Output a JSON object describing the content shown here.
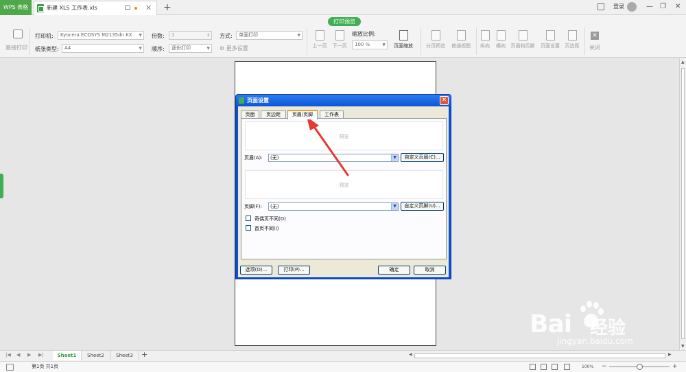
{
  "tabbar": {
    "app_tab": "WPS 表格",
    "doc_tab": "新建 XLS 工作表.xls",
    "login": "登录"
  },
  "ribbon": {
    "title_pill": "打印预览",
    "direct_print": "直接打印",
    "printer_label": "打印机:",
    "printer_value": "Kyocera ECOSYS M2135dn KX",
    "paper_label": "纸张类型:",
    "paper_value": "A4",
    "copies_label": "份数:",
    "copies_value": "1",
    "order_label": "顺序:",
    "order_value": "逐份打印",
    "mode_label": "方式:",
    "mode_value": "单面打印",
    "more_settings": "更多设置",
    "prev_page": "上一页",
    "next_page": "下一页",
    "zoom_label": "缩放比例:",
    "zoom_value": "100 %",
    "page_zoom": "页面缩放",
    "page_break_preview": "分页预览",
    "normal_view": "普通视图",
    "portrait": "纵向",
    "landscape": "横向",
    "header_footer": "页眉和页脚",
    "page_setup": "页面设置",
    "margins": "页边距",
    "close": "关闭"
  },
  "dialog": {
    "title": "页面设置",
    "tabs": [
      "页面",
      "页边距",
      "页眉/页脚",
      "工作表"
    ],
    "active_tab": 2,
    "preview_text": "预览",
    "header_label": "页眉(A):",
    "header_value": "(无)",
    "custom_header": "自定义页眉(C)...",
    "footer_label": "页脚(F):",
    "footer_value": "(无)",
    "custom_footer": "自定义页脚(U)...",
    "odd_even": "奇偶页不同(D)",
    "first_page": "首页不同(I)",
    "options_btn": "选项(O)...",
    "print_btn": "打印(P)...",
    "ok_btn": "确定",
    "cancel_btn": "取消"
  },
  "sheets": {
    "tabs": [
      "Sheet1",
      "Sheet2",
      "Sheet3"
    ],
    "active": 0
  },
  "status": {
    "page_info": "第1页 共1页",
    "zoom": "100%"
  },
  "watermark": {
    "brand": "Bai",
    "site_name": "经验",
    "url": "jingyan.baidu.com"
  },
  "colors": {
    "accent_green": "#3eaf52",
    "dialog_blue": "#0b56d8",
    "annotation_red": "#e53935"
  }
}
